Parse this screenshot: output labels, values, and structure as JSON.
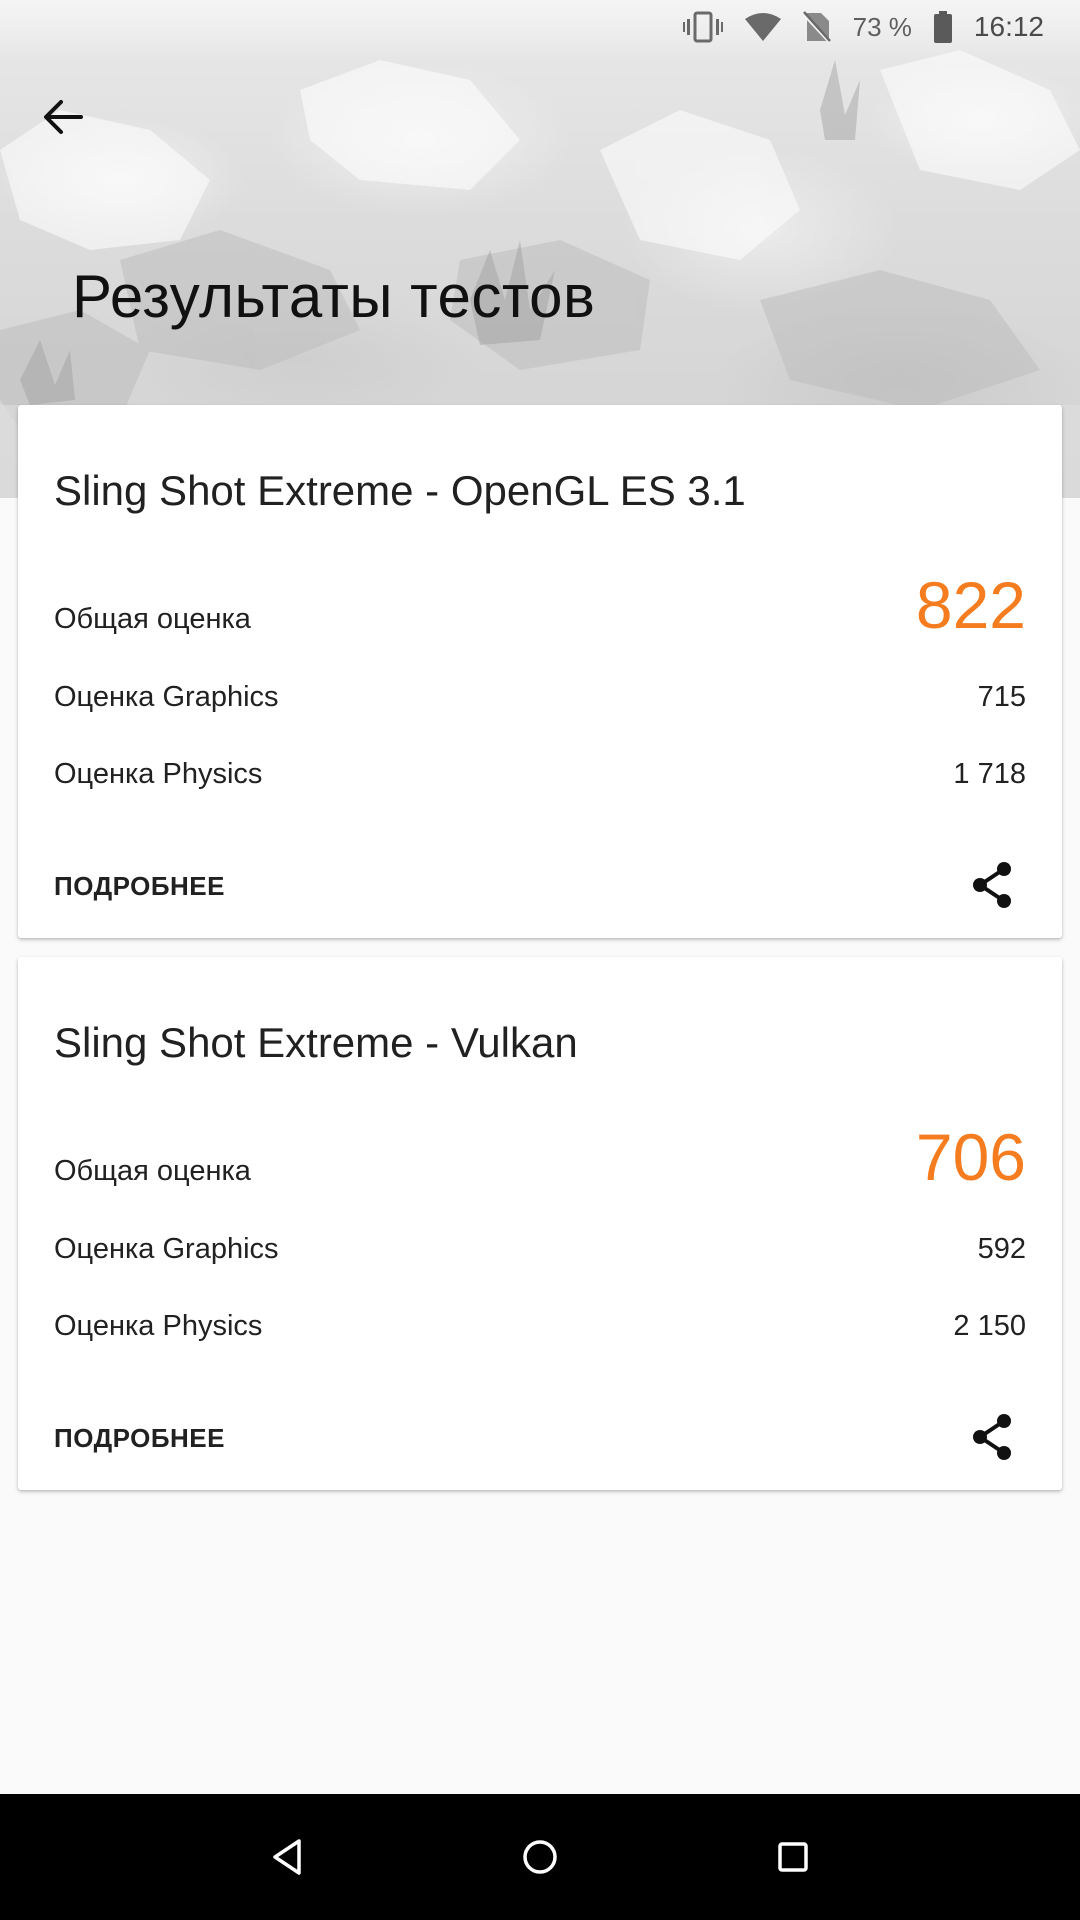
{
  "status_bar": {
    "battery_percent": "73 %",
    "time": "16:12",
    "icons": [
      "vibrate-icon",
      "wifi-icon",
      "no-sim-icon",
      "battery-icon"
    ]
  },
  "header": {
    "title": "Результаты тестов",
    "back_icon": "arrow-back-icon"
  },
  "results": [
    {
      "test_name": "Sling Shot Extreme - OpenGL ES 3.1",
      "total_label": "Общая оценка",
      "total_score": "822",
      "graphics_label": "Оценка Graphics",
      "graphics_score": "715",
      "physics_label": "Оценка Physics",
      "physics_score": "1 718",
      "more_label": "ПОДРОБНЕЕ",
      "share_icon": "share-icon"
    },
    {
      "test_name": "Sling Shot Extreme - Vulkan",
      "total_label": "Общая оценка",
      "total_score": "706",
      "graphics_label": "Оценка Graphics",
      "graphics_score": "592",
      "physics_label": "Оценка Physics",
      "physics_score": "2 150",
      "more_label": "ПОДРОБНЕЕ",
      "share_icon": "share-icon"
    }
  ],
  "nav_bar": {
    "icons": [
      "nav-back-icon",
      "nav-home-icon",
      "nav-recents-icon"
    ]
  },
  "colors": {
    "score_accent": "#f57c1f",
    "background": "#fafafa",
    "card": "#ffffff",
    "nav_bar": "#000000"
  }
}
